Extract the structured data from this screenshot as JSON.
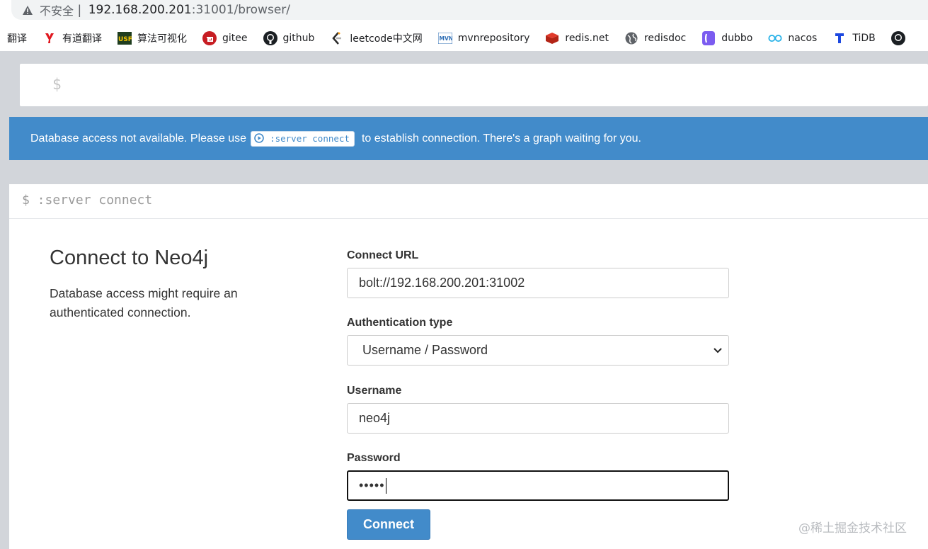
{
  "browser": {
    "insecure_label": "不安全",
    "separator": "|",
    "url_host": "192.168.200.201",
    "url_rest": ":31001/browser/"
  },
  "bookmarks": [
    {
      "label": "翻译",
      "icon": "translate-icon"
    },
    {
      "label": "有道翻译",
      "icon": "youdao-icon"
    },
    {
      "label": "算法可视化",
      "icon": "usf-icon"
    },
    {
      "label": "gitee",
      "icon": "gitee-icon"
    },
    {
      "label": "github",
      "icon": "github-icon"
    },
    {
      "label": "leetcode中文网",
      "icon": "leetcode-icon"
    },
    {
      "label": "mvnrepository",
      "icon": "mvn-icon"
    },
    {
      "label": "redis.net",
      "icon": "redis-icon"
    },
    {
      "label": "redisdoc",
      "icon": "globe-icon"
    },
    {
      "label": "dubbo",
      "icon": "dubbo-icon"
    },
    {
      "label": "nacos",
      "icon": "nacos-icon"
    },
    {
      "label": "TiDB",
      "icon": "tidb-icon"
    }
  ],
  "editor": {
    "prompt": "$"
  },
  "banner": {
    "text_before": "Database access not available. Please use",
    "command": ":server connect",
    "text_after": "to establish connection. There's a graph waiting for you."
  },
  "frame": {
    "command": "$ :server connect",
    "title": "Connect to Neo4j",
    "description": "Database access might require an authenticated connection.",
    "connect_url_label": "Connect URL",
    "connect_url_value": "bolt://192.168.200.201:31002",
    "auth_type_label": "Authentication type",
    "auth_type_value": "Username / Password",
    "username_label": "Username",
    "username_value": "neo4j",
    "password_label": "Password",
    "password_masked": "•••••",
    "connect_button": "Connect"
  },
  "watermark": "@稀土掘金技术社区",
  "colors": {
    "accent": "#428bca",
    "app_background": "#d2d5da"
  }
}
